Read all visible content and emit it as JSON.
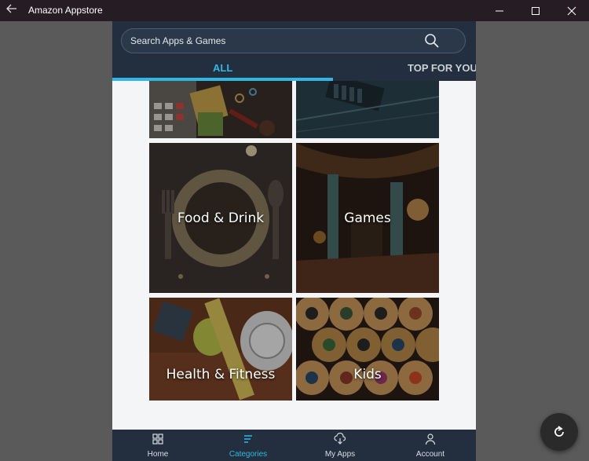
{
  "window": {
    "title": "Amazon Appstore",
    "back_icon": "arrow-left-icon",
    "controls": [
      "minimize-icon",
      "maximize-icon",
      "close-icon"
    ]
  },
  "search": {
    "placeholder": "Search Apps & Games",
    "icon": "search-icon"
  },
  "tabs": [
    {
      "label": "ALL",
      "active": true
    },
    {
      "label": "TOP FOR YOU",
      "active": false
    }
  ],
  "tiles": [
    {
      "label": ""
    },
    {
      "label": ""
    },
    {
      "label": "Food & Drink"
    },
    {
      "label": "Games"
    },
    {
      "label": "Health & Fitness"
    },
    {
      "label": "Kids"
    }
  ],
  "bottom_nav": [
    {
      "label": "Home",
      "icon": "grid-icon",
      "active": false
    },
    {
      "label": "Categories",
      "icon": "list-icon",
      "active": true
    },
    {
      "label": "My Apps",
      "icon": "cloud-download-icon",
      "active": false
    },
    {
      "label": "Account",
      "icon": "person-icon",
      "active": false
    }
  ],
  "refresh_icon": "refresh-icon",
  "colors": {
    "accent": "#2fb8e6",
    "topbar": "#232f3e",
    "titlebar": "#251c24",
    "backdrop": "#5a5a5a"
  }
}
